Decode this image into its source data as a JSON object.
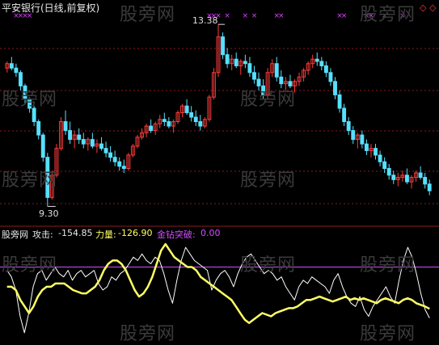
{
  "header": {
    "title": "平安银行(日线,前复权)"
  },
  "price_panel": {
    "high_label": "13.38",
    "low_label": "9.30",
    "high_value": 13.38,
    "low_value": 9.3
  },
  "indicator_panel": {
    "name": "股旁网",
    "attack_label": "攻击:",
    "attack_value": "-154.85",
    "power_label": "力量:",
    "power_value": "-126.90",
    "diamond_label": "金钻突破:",
    "diamond_value": "0.00"
  },
  "watermark": {
    "text": "股旁网"
  },
  "colors": {
    "up": "#ff3b3b",
    "down": "#56e0ff",
    "grid": "#8b1a1a",
    "attack_line": "#ffffff",
    "power_line": "#ffff66",
    "diamond_line": "#d24dff",
    "marker": "#e040ff"
  },
  "icons": {
    "top_right": [
      "diamond-icon",
      "diamond-icon"
    ],
    "marker": "x-mark-icon"
  },
  "chart_data": [
    {
      "type": "candlestick",
      "title": "",
      "ylim": [
        9.0,
        13.6
      ],
      "high": 13.38,
      "low": 9.3,
      "candles": [
        [
          12.4,
          12.55,
          12.3,
          12.5
        ],
        [
          12.5,
          12.65,
          12.35,
          12.4
        ],
        [
          12.4,
          12.5,
          12.2,
          12.3
        ],
        [
          12.3,
          12.35,
          11.9,
          12.0
        ],
        [
          12.0,
          12.05,
          11.6,
          11.7
        ],
        [
          11.7,
          11.75,
          11.4,
          11.5
        ],
        [
          11.5,
          11.55,
          11.1,
          11.2
        ],
        [
          11.2,
          11.25,
          10.8,
          10.9
        ],
        [
          10.9,
          10.95,
          10.3,
          10.4
        ],
        [
          10.4,
          10.5,
          9.3,
          9.5
        ],
        [
          9.5,
          10.1,
          9.45,
          10.0
        ],
        [
          10.0,
          10.7,
          9.95,
          10.6
        ],
        [
          10.6,
          11.3,
          10.55,
          11.2
        ],
        [
          11.2,
          11.45,
          10.9,
          11.0
        ],
        [
          11.0,
          11.2,
          10.7,
          10.8
        ],
        [
          10.8,
          11.0,
          10.6,
          10.9
        ],
        [
          10.9,
          11.05,
          10.7,
          10.8
        ],
        [
          10.8,
          10.95,
          10.6,
          10.7
        ],
        [
          10.7,
          10.85,
          10.55,
          10.8
        ],
        [
          10.8,
          10.95,
          10.6,
          10.65
        ],
        [
          10.65,
          10.8,
          10.5,
          10.7
        ],
        [
          10.7,
          10.85,
          10.55,
          10.6
        ],
        [
          10.6,
          10.75,
          10.4,
          10.5
        ],
        [
          10.5,
          10.65,
          10.3,
          10.4
        ],
        [
          10.4,
          10.55,
          10.2,
          10.3
        ],
        [
          10.3,
          10.4,
          10.1,
          10.2
        ],
        [
          10.2,
          10.35,
          10.05,
          10.15
        ],
        [
          10.15,
          10.5,
          10.1,
          10.45
        ],
        [
          10.45,
          10.7,
          10.4,
          10.65
        ],
        [
          10.65,
          10.9,
          10.6,
          10.85
        ],
        [
          10.85,
          11.05,
          10.8,
          10.95
        ],
        [
          10.95,
          11.15,
          10.85,
          11.1
        ],
        [
          11.1,
          11.25,
          10.95,
          11.0
        ],
        [
          11.0,
          11.2,
          10.9,
          11.15
        ],
        [
          11.15,
          11.35,
          11.05,
          11.25
        ],
        [
          11.25,
          11.4,
          11.1,
          11.2
        ],
        [
          11.2,
          11.3,
          11.05,
          11.1
        ],
        [
          11.1,
          11.25,
          10.95,
          11.2
        ],
        [
          11.2,
          11.45,
          11.15,
          11.4
        ],
        [
          11.4,
          11.6,
          11.3,
          11.55
        ],
        [
          11.55,
          11.7,
          11.35,
          11.4
        ],
        [
          11.4,
          11.55,
          11.2,
          11.3
        ],
        [
          11.3,
          11.45,
          11.1,
          11.2
        ],
        [
          11.2,
          11.35,
          11.0,
          11.1
        ],
        [
          11.1,
          11.3,
          11.05,
          11.25
        ],
        [
          11.25,
          11.8,
          11.2,
          11.75
        ],
        [
          11.75,
          12.4,
          11.7,
          12.3
        ],
        [
          12.3,
          13.38,
          12.2,
          13.1
        ],
        [
          13.1,
          13.2,
          12.6,
          12.7
        ],
        [
          12.7,
          12.85,
          12.4,
          12.5
        ],
        [
          12.5,
          12.7,
          12.35,
          12.6
        ],
        [
          12.6,
          12.75,
          12.4,
          12.45
        ],
        [
          12.45,
          12.6,
          12.25,
          12.55
        ],
        [
          12.55,
          12.7,
          12.4,
          12.5
        ],
        [
          12.5,
          12.65,
          12.2,
          12.3
        ],
        [
          12.3,
          12.45,
          12.05,
          12.15
        ],
        [
          12.15,
          12.3,
          11.9,
          12.0
        ],
        [
          12.0,
          12.15,
          11.7,
          11.8
        ],
        [
          11.8,
          12.4,
          11.75,
          12.3
        ],
        [
          12.3,
          12.6,
          12.2,
          12.5
        ],
        [
          12.5,
          12.65,
          12.1,
          12.2
        ],
        [
          12.2,
          12.35,
          11.95,
          12.05
        ],
        [
          12.05,
          12.2,
          11.9,
          12.1
        ],
        [
          12.1,
          12.25,
          11.95,
          12.0
        ],
        [
          12.0,
          12.15,
          11.85,
          12.1
        ],
        [
          12.1,
          12.3,
          12.0,
          12.2
        ],
        [
          12.2,
          12.4,
          12.1,
          12.35
        ],
        [
          12.35,
          12.55,
          12.25,
          12.5
        ],
        [
          12.5,
          12.7,
          12.4,
          12.6
        ],
        [
          12.6,
          12.75,
          12.45,
          12.55
        ],
        [
          12.55,
          12.65,
          12.35,
          12.45
        ],
        [
          12.45,
          12.55,
          12.2,
          12.3
        ],
        [
          12.3,
          12.4,
          12.0,
          12.1
        ],
        [
          12.1,
          12.2,
          11.7,
          11.8
        ],
        [
          11.8,
          11.9,
          11.4,
          11.5
        ],
        [
          11.5,
          11.6,
          11.1,
          11.2
        ],
        [
          11.2,
          11.3,
          10.9,
          11.0
        ],
        [
          11.0,
          11.1,
          10.7,
          10.8
        ],
        [
          10.8,
          10.95,
          10.6,
          10.9
        ],
        [
          10.9,
          11.0,
          10.6,
          10.7
        ],
        [
          10.7,
          10.8,
          10.45,
          10.55
        ],
        [
          10.55,
          10.7,
          10.4,
          10.6
        ],
        [
          10.6,
          10.7,
          10.35,
          10.45
        ],
        [
          10.45,
          10.55,
          10.2,
          10.3
        ],
        [
          10.3,
          10.4,
          10.05,
          10.15
        ],
        [
          10.15,
          10.25,
          9.9,
          10.0
        ],
        [
          10.0,
          10.1,
          9.8,
          9.9
        ],
        [
          9.9,
          10.05,
          9.75,
          9.95
        ],
        [
          9.95,
          10.1,
          9.85,
          10.0
        ],
        [
          10.0,
          10.15,
          9.8,
          9.85
        ],
        [
          9.85,
          10.0,
          9.7,
          9.95
        ],
        [
          9.95,
          10.1,
          9.85,
          10.05
        ],
        [
          10.05,
          10.2,
          9.9,
          9.95
        ],
        [
          9.95,
          10.05,
          9.7,
          9.8
        ],
        [
          9.8,
          9.9,
          9.55,
          9.65
        ]
      ]
    },
    {
      "type": "line",
      "title": "",
      "ylim": [
        -220,
        80
      ],
      "reference_line": 0.0,
      "series": [
        {
          "name": "攻击",
          "values": [
            -10,
            -30,
            -70,
            -150,
            -200,
            -140,
            -60,
            -20,
            -10,
            -40,
            -20,
            0,
            -20,
            -30,
            -10,
            -40,
            -20,
            -10,
            -30,
            -20,
            -10,
            -50,
            -70,
            -60,
            -30,
            -40,
            -20,
            -10,
            10,
            30,
            20,
            40,
            20,
            10,
            30,
            20,
            -20,
            -70,
            -110,
            -40,
            20,
            60,
            40,
            20,
            10,
            0,
            -10,
            -70,
            -40,
            -20,
            -10,
            -30,
            -60,
            -20,
            10,
            30,
            40,
            20,
            0,
            -20,
            -10,
            -20,
            -40,
            -30,
            -60,
            -80,
            -100,
            -60,
            -40,
            -50,
            -30,
            -40,
            -50,
            -60,
            -80,
            -40,
            -20,
            -60,
            -90,
            -110,
            -120,
            -90,
            -130,
            -150,
            -120,
            -100,
            -80,
            -60,
            -90,
            -110,
            -40,
            20,
            60,
            30,
            -20,
            -80,
            -130,
            -155
          ]
        },
        {
          "name": "力量",
          "values": [
            -60,
            -60,
            -70,
            -100,
            -120,
            -140,
            -120,
            -90,
            -70,
            -60,
            -60,
            -50,
            -50,
            -50,
            -60,
            -70,
            -75,
            -80,
            -80,
            -70,
            -60,
            -40,
            -10,
            10,
            20,
            20,
            10,
            -10,
            -40,
            -70,
            -90,
            -80,
            -60,
            -30,
            10,
            50,
            70,
            50,
            30,
            20,
            10,
            0,
            0,
            -10,
            -30,
            -40,
            -50,
            -60,
            -70,
            -80,
            -90,
            -100,
            -120,
            -140,
            -160,
            -170,
            -160,
            -150,
            -140,
            -145,
            -150,
            -140,
            -135,
            -130,
            -125,
            -125,
            -120,
            -110,
            -100,
            -100,
            -95,
            -90,
            -95,
            -100,
            -105,
            -100,
            -95,
            -90,
            -100,
            -95,
            -100,
            -95,
            -100,
            -105,
            -110,
            -100,
            -95,
            -100,
            -105,
            -110,
            -100,
            -95,
            -100,
            -110,
            -115,
            -120,
            -127
          ]
        }
      ]
    }
  ]
}
